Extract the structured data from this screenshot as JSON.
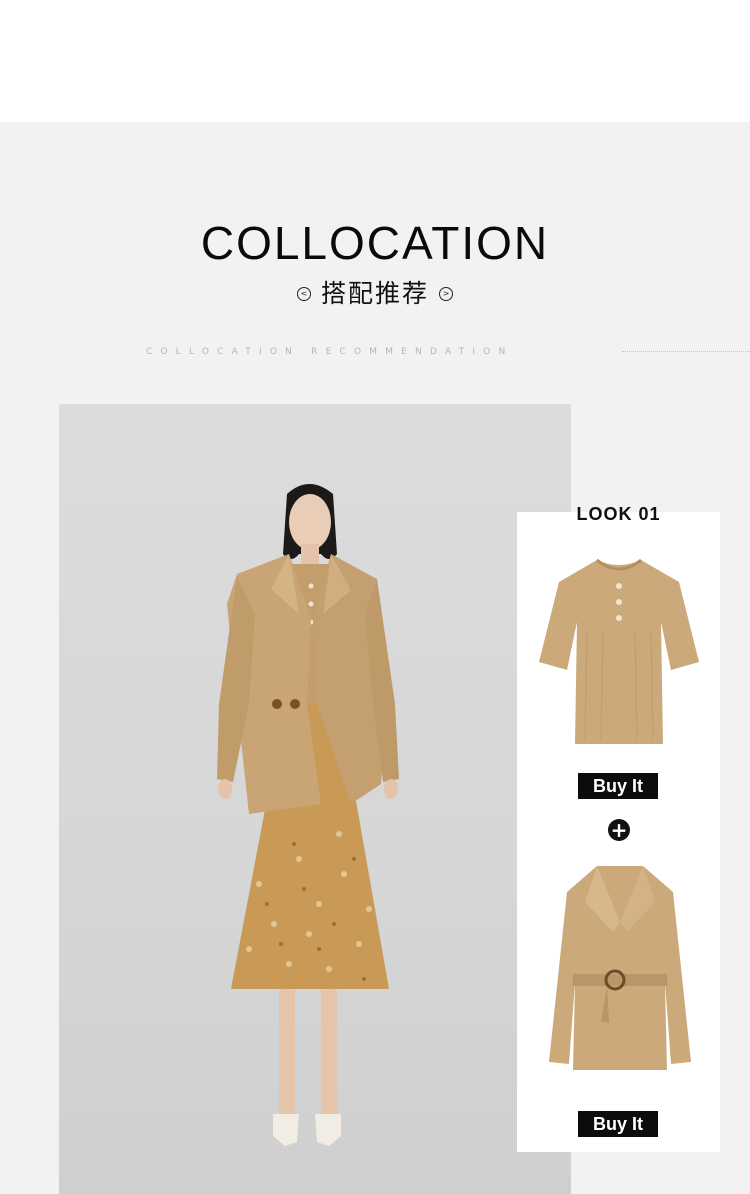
{
  "header": {
    "title": "COLLOCATION",
    "subtitle": "搭配推荐",
    "left_chevron": "<",
    "right_chevron": ">",
    "spaced_caption": "COLLOCATION RECOMMENDATION"
  },
  "look": {
    "label": "LOOK 01",
    "items": [
      {
        "name": "knit-top",
        "buy_label": "Buy It"
      },
      {
        "name": "belted-blazer",
        "buy_label": "Buy It"
      }
    ],
    "plus_symbol": "+"
  },
  "colors": {
    "section_bg": "#f2f2f2",
    "photo_bg": "#d8d8d8",
    "camel": "#c9a575",
    "button_bg": "#0c0c0c",
    "button_text": "#ffffff"
  },
  "icons": [
    "chevron-left-icon",
    "chevron-right-icon",
    "plus-icon"
  ]
}
